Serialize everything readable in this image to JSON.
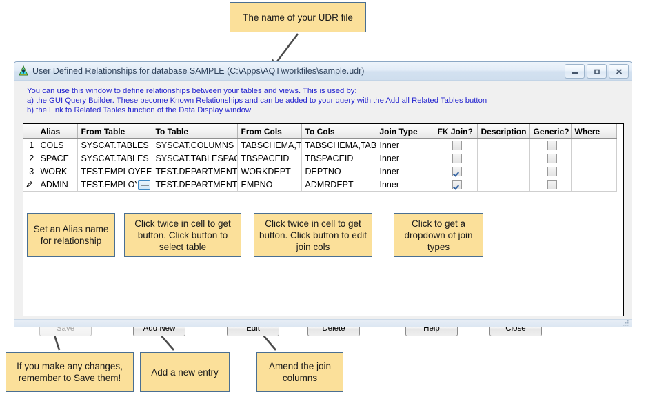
{
  "annotations": {
    "top": "The name of your UDR file",
    "alias": "Set an Alias name for relationship",
    "from_table": "Click twice in cell to get button. Click button to select table",
    "join_cols": "Click twice  in cell to get button. Click button to edit join cols",
    "join_type": "Click to get a dropdown of join types",
    "save": "If you make any changes, remember to Save them!",
    "add_new": "Add a new entry",
    "edit": "Amend the join columns"
  },
  "window": {
    "title": "User Defined Relationships for database SAMPLE (C:\\Apps\\AQT\\workfiles\\sample.udr)",
    "icon": "aqt-logo-icon",
    "controls": {
      "minimize": "minimize-icon",
      "maximize": "maximize-icon",
      "close": "close-icon"
    },
    "info_lines": [
      "You can use this window to define relationships between your tables and views. This is used by:",
      "a) the GUI Query Builder. These become Known Relationships and can be added to your query with the Add all Related Tables button",
      "b) the Link to Related Tables function of the Data Display window"
    ]
  },
  "grid": {
    "headers": [
      "",
      "Alias",
      "From Table",
      "To Table",
      "From Cols",
      "To Cols",
      "Join Type",
      "FK Join?",
      "Description",
      "Generic?",
      "Where"
    ],
    "rows": [
      {
        "num": "1",
        "alias": "COLS",
        "from_table": "SYSCAT.TABLES",
        "to_table": "SYSCAT.COLUMNS",
        "from_cols": "TABSCHEMA,TA",
        "to_cols": "TABSCHEMA,TABN",
        "join_type": "Inner",
        "fk_join": false,
        "description": "",
        "generic": false,
        "where": "",
        "editing": false,
        "cell_button": false
      },
      {
        "num": "2",
        "alias": "SPACE",
        "from_table": "SYSCAT.TABLES",
        "to_table": "SYSCAT.TABLESPACE",
        "from_cols": "TBSPACEID",
        "to_cols": "TBSPACEID",
        "join_type": "Inner",
        "fk_join": false,
        "description": "",
        "generic": false,
        "where": "",
        "editing": false,
        "cell_button": false
      },
      {
        "num": "3",
        "alias": "WORK",
        "from_table": "TEST.EMPLOYEE",
        "to_table": "TEST.DEPARTMENT",
        "from_cols": "WORKDEPT",
        "to_cols": "DEPTNO",
        "join_type": "Inner",
        "fk_join": true,
        "description": "",
        "generic": false,
        "where": "",
        "editing": false,
        "cell_button": false
      },
      {
        "num": "",
        "alias": "ADMIN",
        "from_table": "TEST.EMPLOYE",
        "to_table": "TEST.DEPARTMENT",
        "from_cols": "EMPNO",
        "to_cols": "ADMRDEPT",
        "join_type": "Inner",
        "fk_join": true,
        "description": "",
        "generic": false,
        "where": "",
        "editing": true,
        "cell_button": true
      }
    ]
  },
  "buttons": {
    "save": "Save",
    "add_new": "Add New",
    "edit": "Edit",
    "delete": "Delete",
    "help": "Help",
    "close": "Close"
  },
  "colors": {
    "callout_bg": "#fbe09a",
    "callout_border": "#4a6f92",
    "info_text": "#2323cf",
    "arrow": "#4a4a4a"
  }
}
